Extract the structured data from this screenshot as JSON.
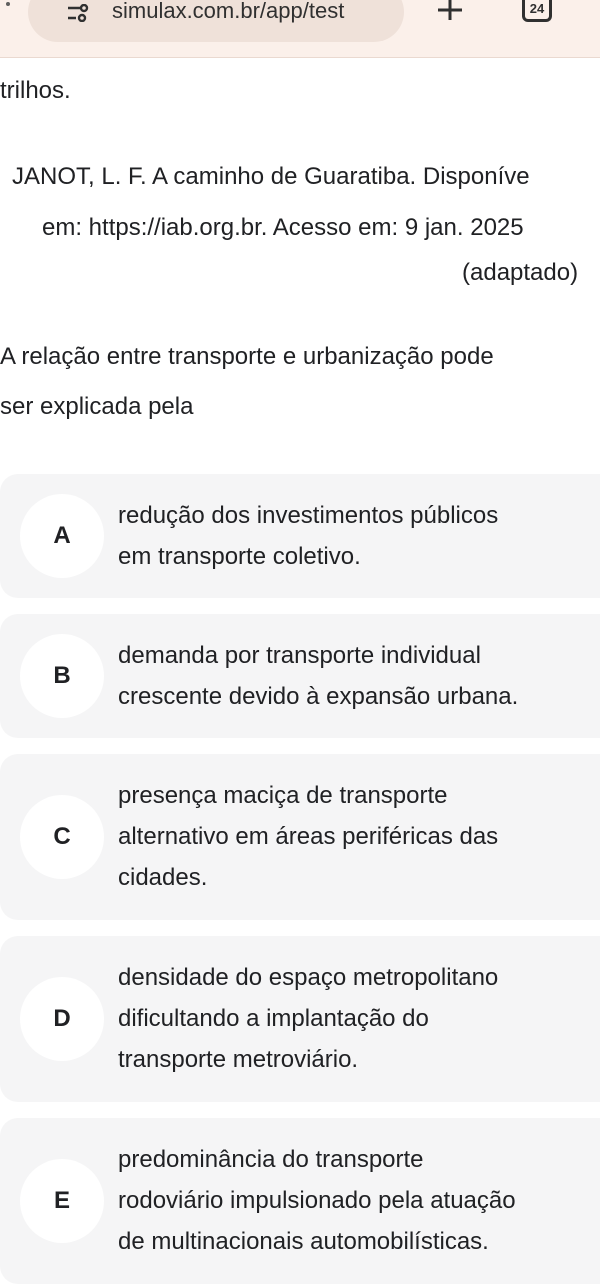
{
  "browser": {
    "url": "simulax.com.br/app/test",
    "tab_count": "24"
  },
  "passage": {
    "trailing_text": "trilhos.",
    "citation_line_1": "JANOT, L. F. A caminho de Guaratiba. Disponíve",
    "citation_line_2": "em: https://iab.org.br. Acesso em: 9 jan. 2025",
    "citation_line_3": "(adaptado)"
  },
  "question": {
    "line_1": "A relação entre transporte e urbanização pode",
    "line_2": "ser explicada pela"
  },
  "options": [
    {
      "letter": "A",
      "lines": [
        "redução dos investimentos públicos",
        "em transporte coletivo."
      ]
    },
    {
      "letter": "B",
      "lines": [
        "demanda por transporte individual",
        "crescente devido à expansão urbana."
      ]
    },
    {
      "letter": "C",
      "lines": [
        "presença maciça de transporte",
        "alternativo em áreas periféricas das",
        "cidades."
      ]
    },
    {
      "letter": "D",
      "lines": [
        "densidade do espaço metropolitano",
        "dificultando a implantação do",
        "transporte metroviário."
      ]
    },
    {
      "letter": "E",
      "lines": [
        "predominância do transporte",
        "rodoviário impulsionado pela atuação",
        "de multinacionais automobilísticas."
      ]
    }
  ]
}
